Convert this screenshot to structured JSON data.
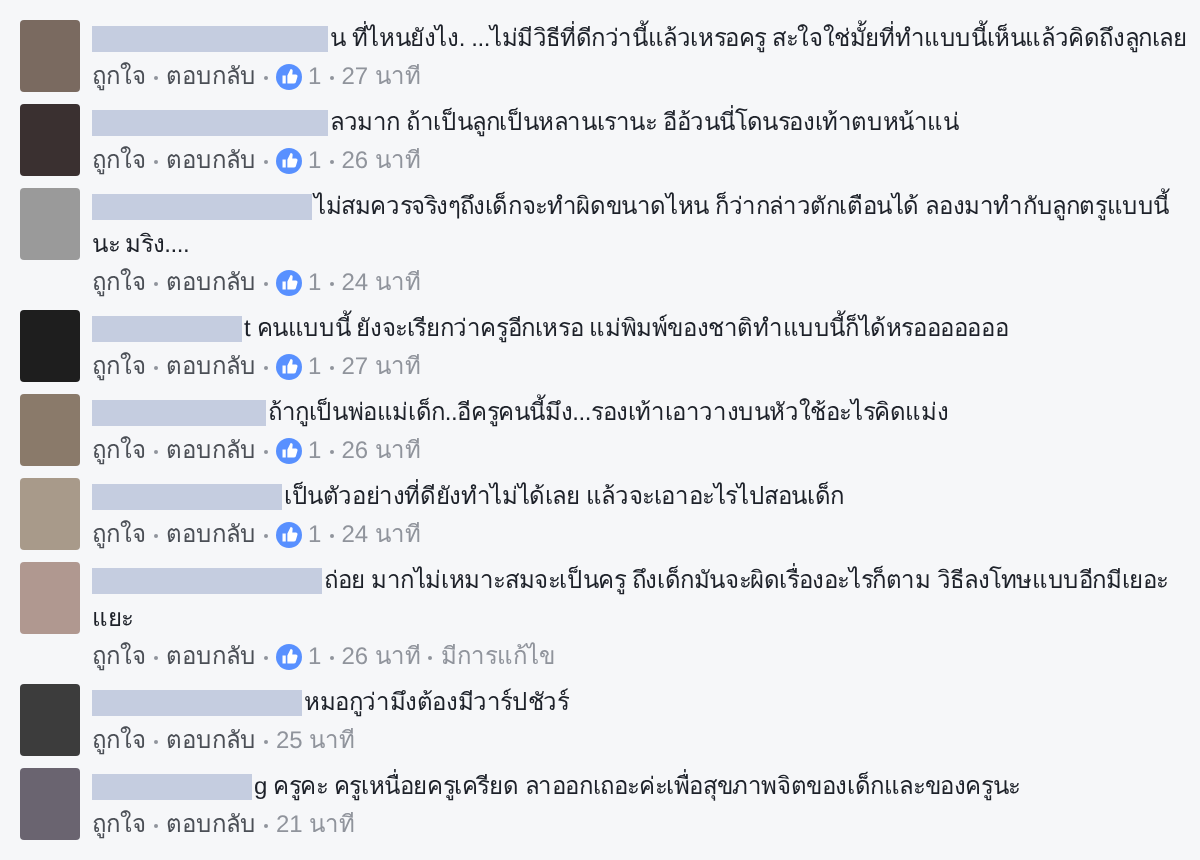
{
  "comments": [
    {
      "lines": [
        "น ที่ไหนยังไง. ...ไม่มีวิธีที่ดีกว่านี้แล้วเหรอครู สะใจใช่มั้ยที่ทำแบบนี้เห็นแล้วคิดถึงลูกเลย"
      ],
      "like": "ถูกใจ",
      "reply": "ตอบกลับ",
      "likes": "1",
      "time": "27 นาที"
    },
    {
      "lines": [
        "ลวมาก ถ้าเป็นลูกเป็นหลานเรานะ อีอ้วนนี่โดนรองเท้าตบหน้าแน่"
      ],
      "like": "ถูกใจ",
      "reply": "ตอบกลับ",
      "likes": "1",
      "time": "26 นาที"
    },
    {
      "lines": [
        "ไม่สมควรจริงๆถึงเด็กจะทำผิดขนาดไหน ก็ว่ากล่าวตักเตือนได้ ลองมาทำกับลูกตรูแบบนี้",
        "นะ มริง...."
      ],
      "like": "ถูกใจ",
      "reply": "ตอบกลับ",
      "likes": "1",
      "time": "24 นาที"
    },
    {
      "lines": [
        "t คนแบบนี้ ยังจะเรียกว่าครูอีกเหรอ แม่พิมพ์ของชาติทำแบบนี้ก็ได้หรอออออออ"
      ],
      "like": "ถูกใจ",
      "reply": "ตอบกลับ",
      "likes": "1",
      "time": "27 นาที"
    },
    {
      "lines": [
        "ถ้ากูเป็นพ่อแม่เด็ก..อีครูคนนี้มึง...รองเท้าเอาวางบนหัวใช้อะไรคิดแม่ง"
      ],
      "like": "ถูกใจ",
      "reply": "ตอบกลับ",
      "likes": "1",
      "time": "26 นาที"
    },
    {
      "lines": [
        "เป็นตัวอย่างที่ดียังทำไม่ได้เลย แล้วจะเอาอะไรไปสอนเด็ก"
      ],
      "like": "ถูกใจ",
      "reply": "ตอบกลับ",
      "likes": "1",
      "time": "24 นาที"
    },
    {
      "lines": [
        "ถ่อย มากไม่เหมาะสมจะเป็นครู ถึงเด็กมันจะผิดเรื่องอะไรก็ตาม วิธีลงโทษแบบอีกมีเยอะ",
        "แยะ"
      ],
      "like": "ถูกใจ",
      "reply": "ตอบกลับ",
      "likes": "1",
      "time": "26 นาที",
      "edited": "มีการแก้ไข"
    },
    {
      "lines": [
        "หมอกูว่ามึงต้องมีวาร์ปชัวร์"
      ],
      "like": "ถูกใจ",
      "reply": "ตอบกลับ",
      "time": "25 นาที"
    },
    {
      "lines": [
        "g ครูคะ ครูเหนื่อยครูเครียด ลาออกเถอะค่ะเพื่อสุขภาพจิตของเด็กและของครูนะ"
      ],
      "like": "ถูกใจ",
      "reply": "ตอบกลับ",
      "time": "21 นาที"
    }
  ]
}
